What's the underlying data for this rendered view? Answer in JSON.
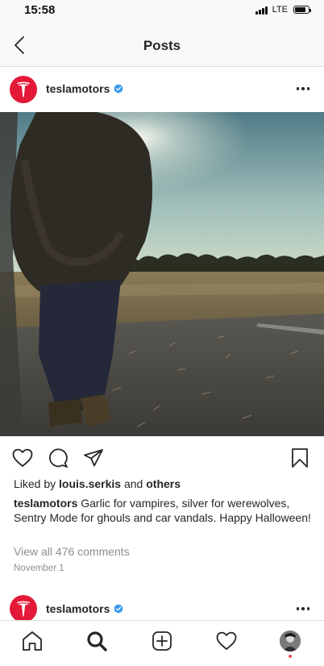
{
  "status_bar": {
    "time": "15:58",
    "network": "LTE",
    "battery_level": 0.8
  },
  "nav": {
    "title": "Posts",
    "back_icon": "chevron-left-icon"
  },
  "post": {
    "username": "teslamotors",
    "verified": true,
    "likes": {
      "prefix": "Liked by",
      "user": "louis.serkis",
      "joiner": "and",
      "others": "others"
    },
    "caption": {
      "user": "teslamotors",
      "text": "Garlic for vampires, silver for werewolves, Sentry Mode for ghouls and car vandals. Happy Halloween!"
    },
    "comments_link": "View all 476 comments",
    "date": "November 1",
    "actions": [
      "heart-icon",
      "comment-icon",
      "share-icon",
      "bookmark-icon"
    ]
  },
  "next_post": {
    "username": "teslamotors",
    "verified": true
  },
  "tab_bar": {
    "tabs": [
      "home-icon",
      "search-icon",
      "new-post-icon",
      "activity-heart-icon",
      "profile-avatar"
    ]
  },
  "colors": {
    "brand_red": "#e31937",
    "verified_blue": "#3897f0",
    "notification_red": "#ed4956",
    "muted_text": "#8e8e8e",
    "primary_text": "#262626"
  }
}
